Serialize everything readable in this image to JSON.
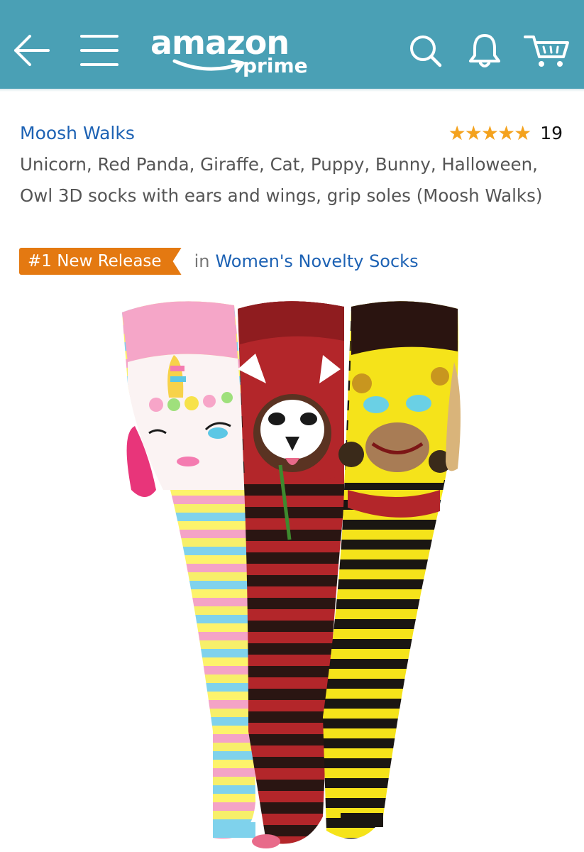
{
  "header": {
    "logo_text": "amazon",
    "logo_sub": "prime",
    "icons": [
      "back-arrow-icon",
      "hamburger-menu-icon",
      "search-icon",
      "bell-icon",
      "cart-icon"
    ],
    "background_color": "#4aa0b5"
  },
  "product": {
    "brand": "Moosh Walks",
    "rating": {
      "stars_filled": 5,
      "stars_total": 5,
      "star_glyph": "★",
      "count": "19",
      "star_color": "#f4a21d"
    },
    "title": "Unicorn, Red Panda, Giraffe, Cat, Puppy, Bunny, Halloween, Owl 3D socks with ears and wings, grip soles (Moosh Walks)",
    "badge": {
      "label": "#1 New Release",
      "in_text": "in",
      "category": "Women's Novelty Socks",
      "color": "#e47911"
    },
    "image": {
      "description_icon": "product-photo-socks"
    }
  },
  "colors": {
    "link": "#1d62b4",
    "body_text": "#555555"
  }
}
